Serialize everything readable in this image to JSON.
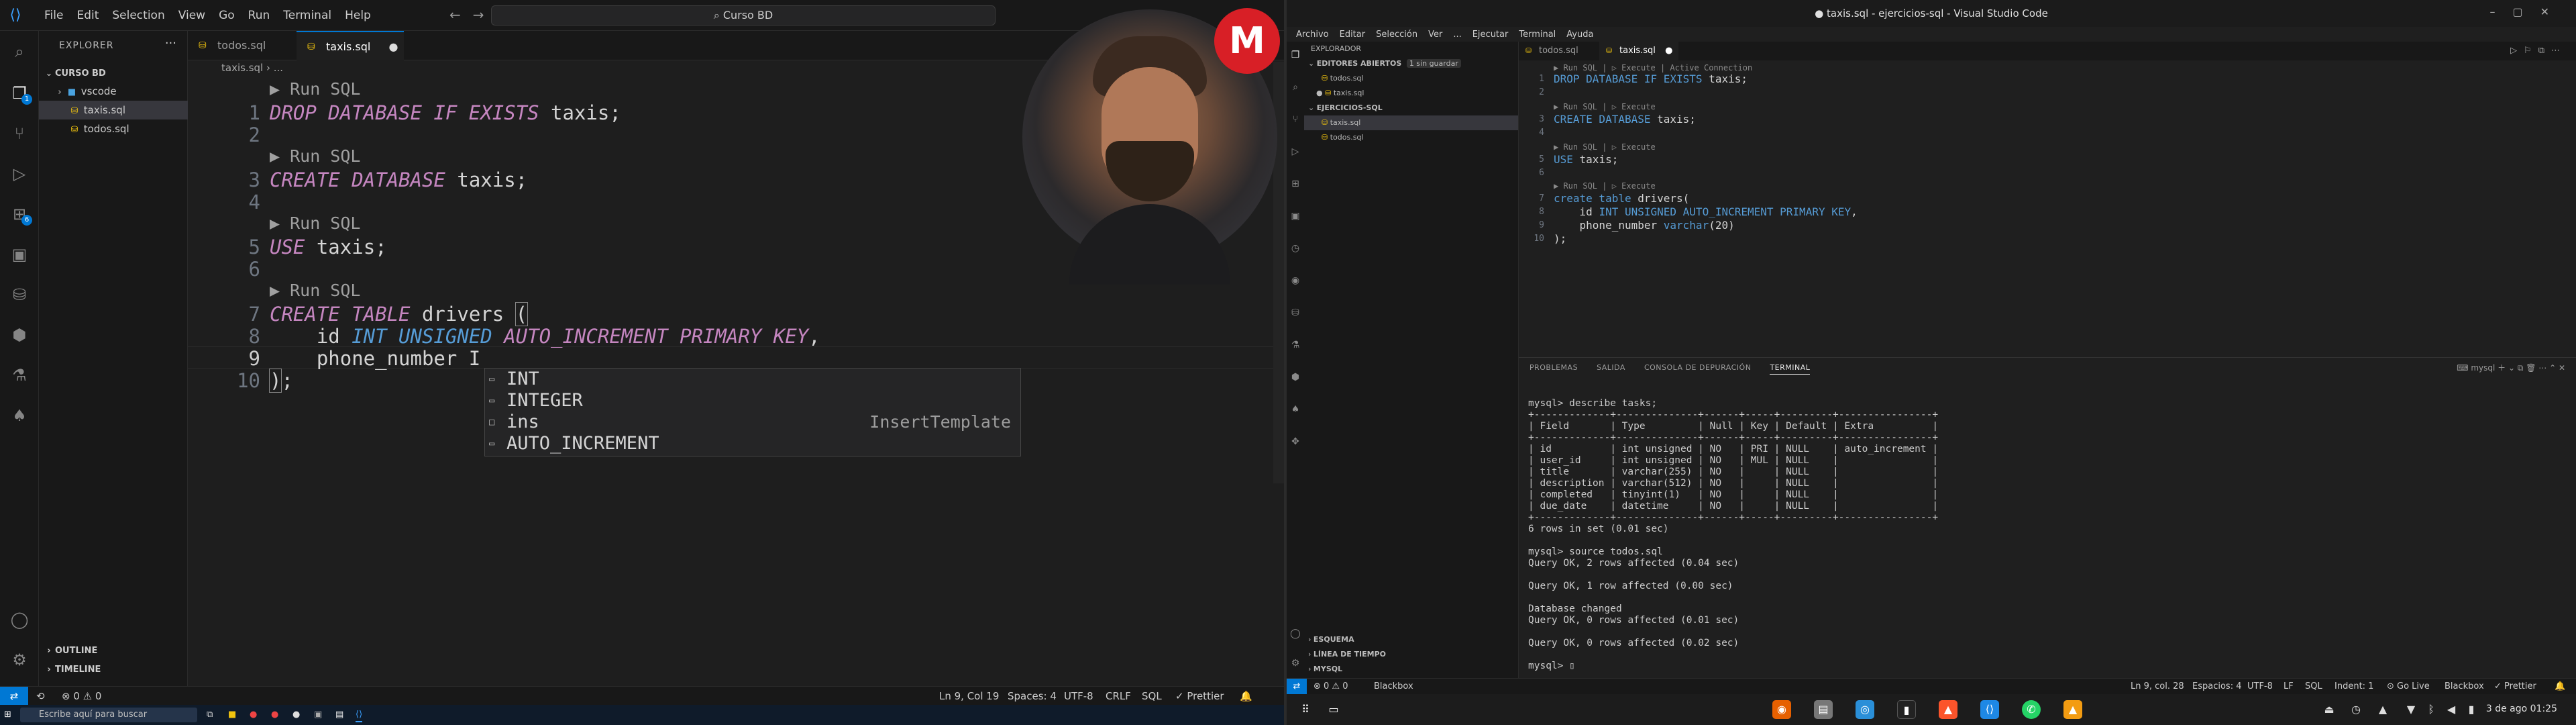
{
  "left": {
    "menu": [
      "File",
      "Edit",
      "Selection",
      "View",
      "Go",
      "Run",
      "Terminal",
      "Help"
    ],
    "command_center": "Curso BD",
    "explorer": {
      "title": "EXPLORER",
      "root": "CURSO BD",
      "items": [
        {
          "name": "vscode",
          "kind": "folder"
        },
        {
          "name": "taxis.sql",
          "kind": "file",
          "selected": true
        },
        {
          "name": "todos.sql",
          "kind": "file"
        }
      ],
      "outline": "OUTLINE",
      "timeline": "TIMELINE"
    },
    "tabs": [
      {
        "label": "todos.sql",
        "active": false
      },
      {
        "label": "taxis.sql",
        "active": true,
        "dirty": "●"
      }
    ],
    "breadcrumb": "taxis.sql › ...",
    "code": {
      "lens": "▶ Run SQL",
      "lines": [
        {
          "n": "1",
          "text": "DROP DATABASE IF EXISTS taxis;"
        },
        {
          "n": "2",
          "text": ""
        },
        {
          "n": "3",
          "text": "CREATE DATABASE taxis;"
        },
        {
          "n": "4",
          "text": ""
        },
        {
          "n": "5",
          "text": "USE taxis;"
        },
        {
          "n": "6",
          "text": ""
        },
        {
          "n": "7",
          "text": "CREATE TABLE drivers ("
        },
        {
          "n": "8",
          "text": "    id INT UNSIGNED AUTO_INCREMENT PRIMARY KEY,"
        },
        {
          "n": "9",
          "text": "    phone_number I"
        },
        {
          "n": "10",
          "text": ");"
        }
      ]
    },
    "suggestions": [
      {
        "label": "INT",
        "detail": ""
      },
      {
        "label": "INTEGER",
        "detail": ""
      },
      {
        "label": "ins",
        "detail": "InsertTemplate"
      },
      {
        "label": "AUTO_INCREMENT",
        "detail": ""
      }
    ],
    "status": {
      "errors": "⊗ 0 ⚠ 0",
      "position": "Ln 9, Col 19",
      "spaces": "Spaces: 4",
      "encoding": "UTF-8",
      "eol": "CRLF",
      "lang": "SQL",
      "prettier": "✓ Prettier"
    },
    "taskbar_search": "Escribe aquí para buscar"
  },
  "right": {
    "title": "● taxis.sql - ejercicios-sql - Visual Studio Code",
    "menu": [
      "Archivo",
      "Editar",
      "Selección",
      "Ver",
      "...",
      "Ejecutar",
      "Terminal",
      "Ayuda"
    ],
    "explorer": {
      "title": "EXPLORADOR",
      "open_editors": "EDITORES ABIERTOS",
      "unsaved": "1 sin guardar",
      "open": [
        "todos.sql",
        "taxis.sql"
      ],
      "folder": "EJERCICIOS-SQL",
      "files": [
        "taxis.sql",
        "todos.sql"
      ],
      "esquema": "ESQUEMA",
      "linea": "LÍNEA DE TIEMPO",
      "mysql": "MYSQL"
    },
    "tabs": [
      "todos.sql",
      "taxis.sql"
    ],
    "lens": "▶ Run SQL | ▷ Execute",
    "active_conn": "Active Connection",
    "code": [
      {
        "n": "1",
        "text": "DROP DATABASE IF EXISTS taxis;"
      },
      {
        "n": "2",
        "text": ""
      },
      {
        "n": "3",
        "text": "CREATE DATABASE taxis;"
      },
      {
        "n": "4",
        "text": ""
      },
      {
        "n": "5",
        "text": "USE taxis;"
      },
      {
        "n": "6",
        "text": ""
      },
      {
        "n": "7",
        "text": "create table drivers("
      },
      {
        "n": "8",
        "text": "    id INT UNSIGNED AUTO_INCREMENT PRIMARY KEY,"
      },
      {
        "n": "9",
        "text": "    phone_number varchar(20)"
      },
      {
        "n": "10",
        "text": ");"
      }
    ],
    "panel_tabs": [
      "PROBLEMAS",
      "SALIDA",
      "CONSOLA DE DEPURACIÓN",
      "TERMINAL"
    ],
    "panel_right": "mysql",
    "terminal": "mysql> describe tasks;\n+-------------+--------------+------+-----+---------+----------------+\n| Field       | Type         | Null | Key | Default | Extra          |\n+-------------+--------------+------+-----+---------+----------------+\n| id          | int unsigned | NO   | PRI | NULL    | auto_increment |\n| user_id     | int unsigned | NO   | MUL | NULL    |                |\n| title       | varchar(255) | NO   |     | NULL    |                |\n| description | varchar(512) | NO   |     | NULL    |                |\n| completed   | tinyint(1)   | NO   |     | NULL    |                |\n| due_date    | datetime     | NO   |     | NULL    |                |\n+-------------+--------------+------+-----+---------+----------------+\n6 rows in set (0.01 sec)\n\nmysql> source todos.sql\nQuery OK, 2 rows affected (0.04 sec)\n\nQuery OK, 1 row affected (0.00 sec)\n\nDatabase changed\nQuery OK, 0 rows affected (0.01 sec)\n\nQuery OK, 0 rows affected (0.02 sec)\n\nmysql> ▯",
    "status": {
      "problems": "⊗ 0 ⚠ 0",
      "blackbox": "Blackbox",
      "position": "Ln 9, col. 28",
      "spaces": "Espacios: 4",
      "encoding": "UTF-8",
      "eol": "LF",
      "lang": "SQL",
      "indent": "Indent: 1",
      "golive": "⊙ Go Live",
      "blackbox2": "Blackbox",
      "prettier": "✓ Prettier"
    },
    "clock": "3 de ago 01:25"
  },
  "overlay_logo": "M"
}
